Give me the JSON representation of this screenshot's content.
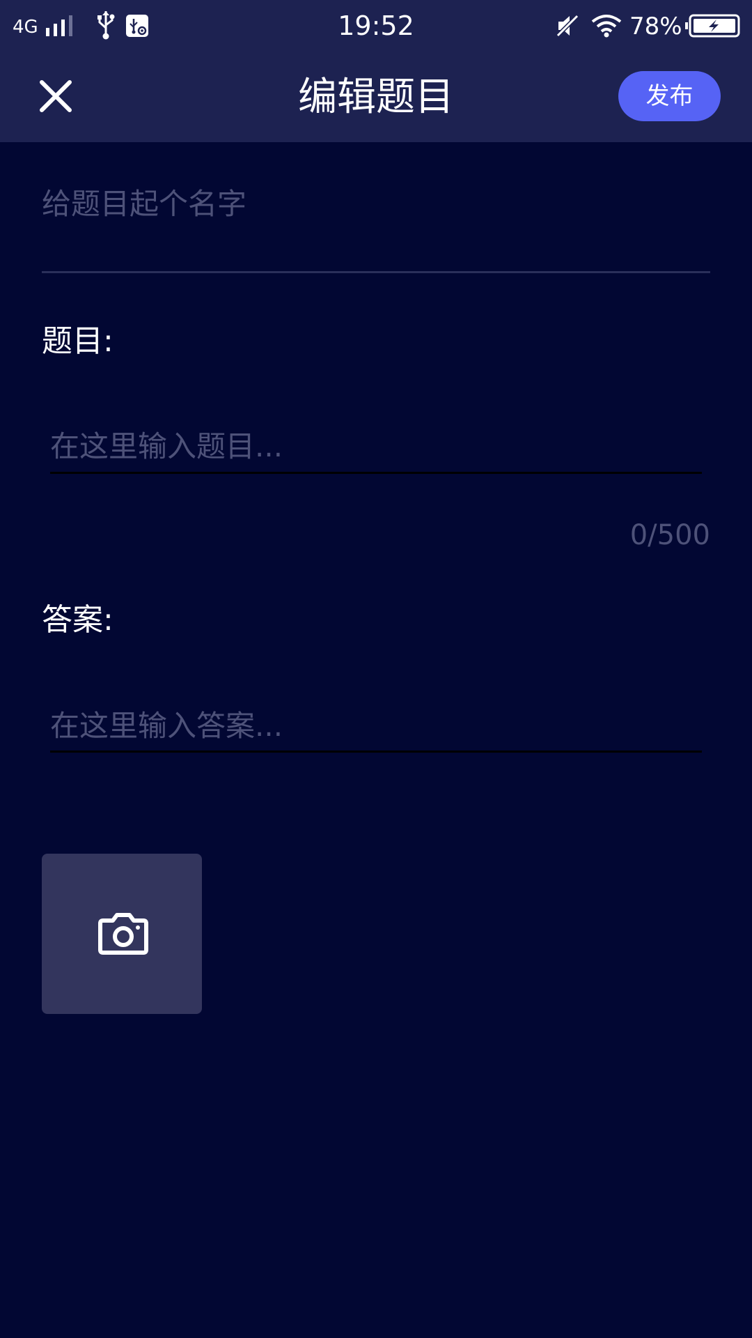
{
  "status_bar": {
    "network_type": "4G",
    "time": "19:52",
    "battery_percent": "78%",
    "icons": [
      "signal-icon",
      "usb-icon",
      "usb-debug-icon",
      "mute-icon",
      "wifi-icon",
      "battery-charging-icon"
    ]
  },
  "header": {
    "title": "编辑题目",
    "publish_label": "发布",
    "close_icon": "close-icon"
  },
  "form": {
    "name_placeholder": "给题目起个名字",
    "question_label": "题目:",
    "question_placeholder": "在这里输入题目...",
    "char_counter": "0/500",
    "answer_label": "答案:",
    "answer_placeholder": "在这里输入答案...",
    "add_photo_icon": "camera-icon"
  },
  "colors": {
    "background": "#020733",
    "header": "#1d2251",
    "accent": "#5663f5",
    "placeholder": "#4e5279",
    "photo_tile": "#33355d"
  }
}
